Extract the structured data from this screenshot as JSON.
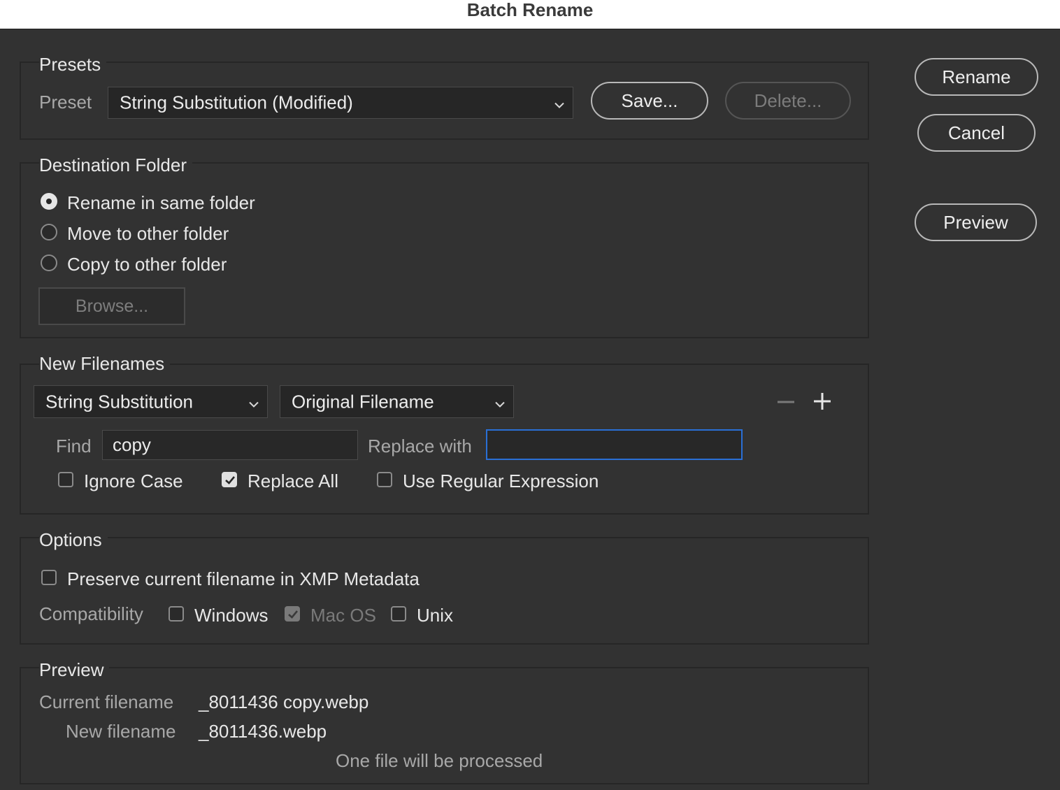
{
  "window": {
    "title": "Batch Rename"
  },
  "actions": {
    "rename": "Rename",
    "cancel": "Cancel",
    "preview": "Preview"
  },
  "presets": {
    "legend": "Presets",
    "preset_label": "Preset",
    "preset_value": "String Substitution (Modified)",
    "save": "Save...",
    "delete": "Delete..."
  },
  "destination": {
    "legend": "Destination Folder",
    "options": [
      "Rename in same folder",
      "Move to other folder",
      "Copy to other folder"
    ],
    "selected": "Rename in same folder",
    "browse": "Browse..."
  },
  "filenames": {
    "legend": "New Filenames",
    "type_value": "String Substitution",
    "source_value": "Original Filename",
    "find_label": "Find",
    "find_value": "copy",
    "replace_label": "Replace with",
    "replace_value": "",
    "ignore_case": "Ignore Case",
    "replace_all": "Replace All",
    "use_regex": "Use Regular Expression",
    "ignore_case_checked": false,
    "replace_all_checked": true,
    "use_regex_checked": false
  },
  "options": {
    "legend": "Options",
    "preserve": "Preserve current filename in XMP Metadata",
    "preserve_checked": false,
    "compat_label": "Compatibility",
    "windows": "Windows",
    "macos": "Mac OS",
    "unix": "Unix",
    "windows_checked": false,
    "macos_checked": true,
    "unix_checked": false
  },
  "preview": {
    "legend": "Preview",
    "current_label": "Current filename",
    "current_value": "_8011436 copy.webp",
    "new_label": "New filename",
    "new_value": "_8011436.webp",
    "status": "One file will be processed"
  },
  "colors": {
    "background": "#323232",
    "focus_ring": "#2a6fd6",
    "titlebar": "#ffffff"
  },
  "icons": [
    "chevron-down-icon",
    "minus-icon",
    "plus-icon",
    "checkmark-icon"
  ]
}
